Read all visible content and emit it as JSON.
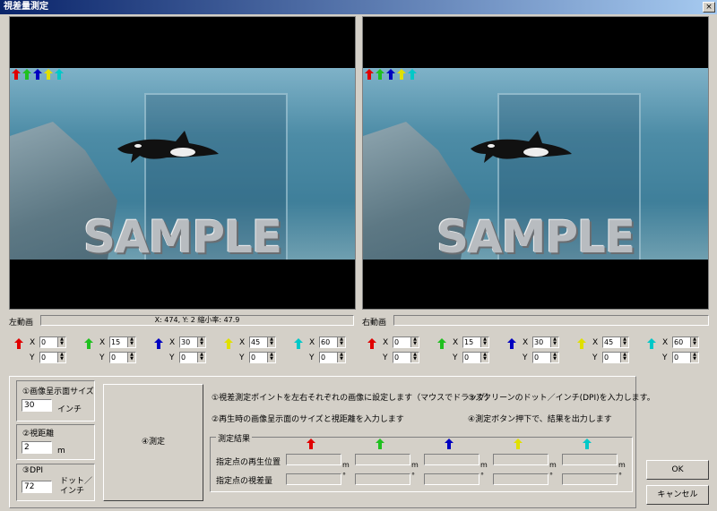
{
  "window": {
    "title": "視差量測定",
    "close": "×"
  },
  "left_video": {
    "label": "左動画",
    "status": "X: 474, Y: 2  縮小率: 47.9",
    "watermark": "SAMPLE"
  },
  "right_video": {
    "label": "右動画",
    "status": "",
    "watermark": "SAMPLE"
  },
  "points_left": [
    {
      "color": "#e00000",
      "num": "1",
      "x": "0",
      "y": "0"
    },
    {
      "color": "#20c020",
      "num": "2",
      "x": "15",
      "y": "0"
    },
    {
      "color": "#0000c0",
      "num": "3",
      "x": "30",
      "y": "0"
    },
    {
      "color": "#e0e000",
      "num": "4",
      "x": "45",
      "y": "0"
    },
    {
      "color": "#00c8c8",
      "num": "5",
      "x": "60",
      "y": "0"
    }
  ],
  "points_right": [
    {
      "color": "#e00000",
      "num": "1",
      "x": "0",
      "y": "0"
    },
    {
      "color": "#20c020",
      "num": "2",
      "x": "15",
      "y": "0"
    },
    {
      "color": "#0000c0",
      "num": "3",
      "x": "30",
      "y": "0"
    },
    {
      "color": "#e0e000",
      "num": "4",
      "x": "45",
      "y": "0"
    },
    {
      "color": "#00c8c8",
      "num": "5",
      "x": "60",
      "y": "0"
    }
  ],
  "axis": {
    "x": "X",
    "y": "Y"
  },
  "screen_size": {
    "label": "①画像呈示面サイズ",
    "value": "30",
    "unit": "インチ"
  },
  "distance": {
    "label": "②視距離",
    "value": "2",
    "unit": "m"
  },
  "dpi": {
    "label": "③DPI",
    "value": "72",
    "unit": "ドット／インチ"
  },
  "measure_button": "④測定",
  "instructions": {
    "i1": "①視差測定ポイントを左右それぞれの画像に設定します（マウスでドラッグ）",
    "i2": "②再生時の画像呈示面のサイズと視距離を入力します",
    "i3": "③スクリーンのドット／インチ(DPI)を入力します。",
    "i4": "④測定ボタン押下で、結果を出力します"
  },
  "results": {
    "title": "測定結果",
    "row1_label": "指定点の再生位置",
    "row2_label": "指定点の視差量",
    "unit_m": "m",
    "unit_deg": "°",
    "colors": [
      "#e00000",
      "#20c020",
      "#0000c0",
      "#e0e000",
      "#00c8c8"
    ]
  },
  "buttons": {
    "ok": "OK",
    "cancel": "キャンセル"
  }
}
